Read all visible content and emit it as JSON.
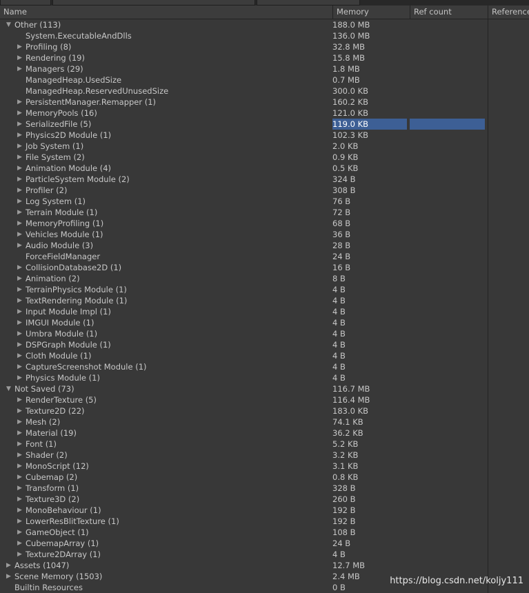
{
  "columns": [
    "Name",
    "Memory",
    "Ref count",
    "Reference"
  ],
  "rows": [
    {
      "name": "Other (113)",
      "mem": "188.0 MB",
      "level": 0,
      "exp": "open"
    },
    {
      "name": "System.ExecutableAndDlls",
      "mem": "136.0 MB",
      "level": 1,
      "exp": "none"
    },
    {
      "name": "Profiling (8)",
      "mem": "32.8 MB",
      "level": 1,
      "exp": "closed"
    },
    {
      "name": "Rendering (19)",
      "mem": "15.8 MB",
      "level": 1,
      "exp": "closed"
    },
    {
      "name": "Managers (29)",
      "mem": "1.8 MB",
      "level": 1,
      "exp": "closed"
    },
    {
      "name": "ManagedHeap.UsedSize",
      "mem": "0.7 MB",
      "level": 1,
      "exp": "none"
    },
    {
      "name": "ManagedHeap.ReservedUnusedSize",
      "mem": "300.0 KB",
      "level": 1,
      "exp": "none"
    },
    {
      "name": "PersistentManager.Remapper (1)",
      "mem": "160.2 KB",
      "level": 1,
      "exp": "closed"
    },
    {
      "name": "MemoryPools (16)",
      "mem": "121.0 KB",
      "level": 1,
      "exp": "closed"
    },
    {
      "name": "SerializedFile (5)",
      "mem": "119.0 KB",
      "level": 1,
      "exp": "closed",
      "selected": true
    },
    {
      "name": "Physics2D Module (1)",
      "mem": "102.3 KB",
      "level": 1,
      "exp": "closed"
    },
    {
      "name": "Job System (1)",
      "mem": "2.0 KB",
      "level": 1,
      "exp": "closed"
    },
    {
      "name": "File System (2)",
      "mem": "0.9 KB",
      "level": 1,
      "exp": "closed"
    },
    {
      "name": "Animation Module (4)",
      "mem": "0.5 KB",
      "level": 1,
      "exp": "closed"
    },
    {
      "name": "ParticleSystem Module (2)",
      "mem": "324 B",
      "level": 1,
      "exp": "closed"
    },
    {
      "name": "Profiler (2)",
      "mem": "308 B",
      "level": 1,
      "exp": "closed"
    },
    {
      "name": "Log System (1)",
      "mem": "76 B",
      "level": 1,
      "exp": "closed"
    },
    {
      "name": "Terrain Module (1)",
      "mem": "72 B",
      "level": 1,
      "exp": "closed"
    },
    {
      "name": "MemoryProfiling (1)",
      "mem": "68 B",
      "level": 1,
      "exp": "closed"
    },
    {
      "name": "Vehicles Module (1)",
      "mem": "36 B",
      "level": 1,
      "exp": "closed"
    },
    {
      "name": "Audio Module (3)",
      "mem": "28 B",
      "level": 1,
      "exp": "closed"
    },
    {
      "name": "ForceFieldManager",
      "mem": "24 B",
      "level": 1,
      "exp": "none"
    },
    {
      "name": "CollisionDatabase2D (1)",
      "mem": "16 B",
      "level": 1,
      "exp": "closed"
    },
    {
      "name": "Animation (2)",
      "mem": "8 B",
      "level": 1,
      "exp": "closed"
    },
    {
      "name": "TerrainPhysics Module (1)",
      "mem": "4 B",
      "level": 1,
      "exp": "closed"
    },
    {
      "name": "TextRendering Module (1)",
      "mem": "4 B",
      "level": 1,
      "exp": "closed"
    },
    {
      "name": "Input Module Impl (1)",
      "mem": "4 B",
      "level": 1,
      "exp": "closed"
    },
    {
      "name": "IMGUI Module (1)",
      "mem": "4 B",
      "level": 1,
      "exp": "closed"
    },
    {
      "name": "Umbra Module (1)",
      "mem": "4 B",
      "level": 1,
      "exp": "closed"
    },
    {
      "name": "DSPGraph Module (1)",
      "mem": "4 B",
      "level": 1,
      "exp": "closed"
    },
    {
      "name": "Cloth Module (1)",
      "mem": "4 B",
      "level": 1,
      "exp": "closed"
    },
    {
      "name": "CaptureScreenshot Module (1)",
      "mem": "4 B",
      "level": 1,
      "exp": "closed"
    },
    {
      "name": "Physics Module (1)",
      "mem": "4 B",
      "level": 1,
      "exp": "closed"
    },
    {
      "name": "Not Saved (73)",
      "mem": "116.7 MB",
      "level": 0,
      "exp": "open"
    },
    {
      "name": "RenderTexture (5)",
      "mem": "116.4 MB",
      "level": 1,
      "exp": "closed"
    },
    {
      "name": "Texture2D (22)",
      "mem": "183.0 KB",
      "level": 1,
      "exp": "closed"
    },
    {
      "name": "Mesh (2)",
      "mem": "74.1 KB",
      "level": 1,
      "exp": "closed"
    },
    {
      "name": "Material (19)",
      "mem": "36.2 KB",
      "level": 1,
      "exp": "closed"
    },
    {
      "name": "Font (1)",
      "mem": "5.2 KB",
      "level": 1,
      "exp": "closed"
    },
    {
      "name": "Shader (2)",
      "mem": "3.2 KB",
      "level": 1,
      "exp": "closed"
    },
    {
      "name": "MonoScript (12)",
      "mem": "3.1 KB",
      "level": 1,
      "exp": "closed"
    },
    {
      "name": "Cubemap (2)",
      "mem": "0.8 KB",
      "level": 1,
      "exp": "closed"
    },
    {
      "name": "Transform (1)",
      "mem": "328 B",
      "level": 1,
      "exp": "closed"
    },
    {
      "name": "Texture3D (2)",
      "mem": "260 B",
      "level": 1,
      "exp": "closed"
    },
    {
      "name": "MonoBehaviour (1)",
      "mem": "192 B",
      "level": 1,
      "exp": "closed"
    },
    {
      "name": "LowerResBlitTexture (1)",
      "mem": "192 B",
      "level": 1,
      "exp": "closed"
    },
    {
      "name": "GameObject (1)",
      "mem": "108 B",
      "level": 1,
      "exp": "closed"
    },
    {
      "name": "CubemapArray (1)",
      "mem": "24 B",
      "level": 1,
      "exp": "closed"
    },
    {
      "name": "Texture2DArray (1)",
      "mem": "4 B",
      "level": 1,
      "exp": "closed"
    },
    {
      "name": "Assets (1047)",
      "mem": "12.7 MB",
      "level": 0,
      "exp": "closed"
    },
    {
      "name": "Scene Memory (1503)",
      "mem": "2.4 MB",
      "level": 0,
      "exp": "closed"
    },
    {
      "name": "Builtin Resources",
      "mem": "0 B",
      "level": 0,
      "exp": "none"
    }
  ],
  "watermark": "https://blog.csdn.net/koljy111",
  "colors": {
    "selection": "#3d5f95",
    "background": "#383838"
  }
}
